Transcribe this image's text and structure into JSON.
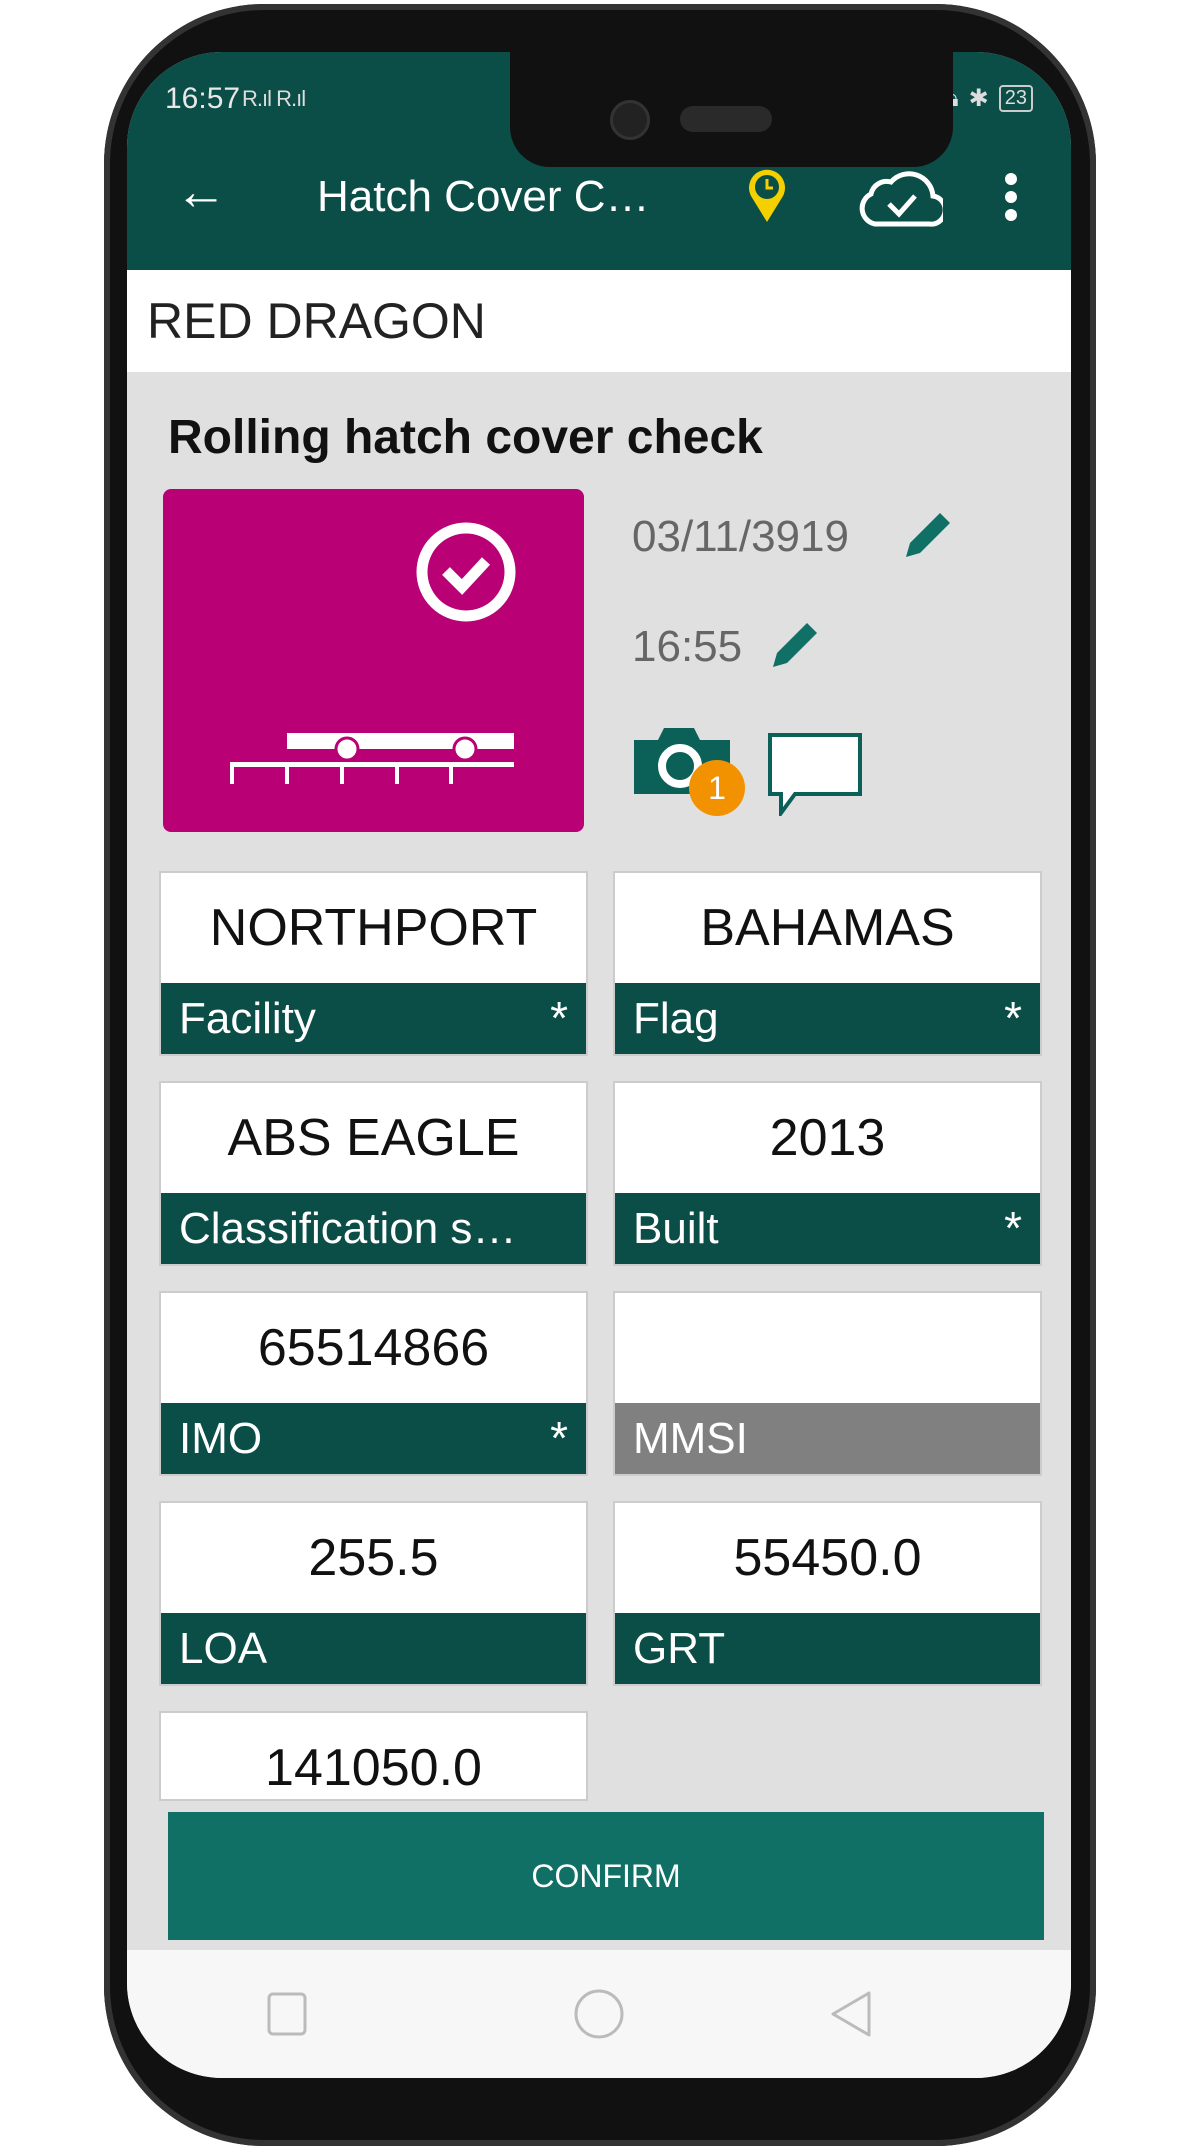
{
  "status_bar": {
    "time": "16:57",
    "signal": "R.ıl R.ıl",
    "battery": "23"
  },
  "app_bar": {
    "title": "Hatch Cover Check",
    "back_icon": "arrow-left-icon",
    "location_icon": "location-clock-pin-icon",
    "sync_icon": "cloud-check-icon",
    "menu_icon": "more-vertical-icon"
  },
  "vessel_name": "RED DRAGON",
  "check": {
    "title": "Rolling hatch cover check",
    "date": "03/11/3919",
    "time": "16:55",
    "photo_count": "1",
    "tile_color": "#b90074"
  },
  "fields": [
    {
      "value": "NORTHPORT",
      "label": "Facility",
      "required": true
    },
    {
      "value": "BAHAMAS",
      "label": "Flag",
      "required": true
    },
    {
      "value": "ABS EAGLE",
      "label": "Classification society",
      "required": false
    },
    {
      "value": "2013",
      "label": "Built",
      "required": true
    },
    {
      "value": "65514866",
      "label": "IMO",
      "required": true
    },
    {
      "value": "",
      "label": "MMSI",
      "required": false,
      "disabled": true
    },
    {
      "value": "255.5",
      "label": "LOA",
      "required": false
    },
    {
      "value": "55450.0",
      "label": "GRT",
      "required": false
    },
    {
      "value": "141050.0",
      "label": "",
      "required": false
    }
  ],
  "confirm_label": "CONFIRM",
  "colors": {
    "primary": "#0b4d47",
    "button": "#107066",
    "accent": "#f39200",
    "pin": "#f5d000"
  }
}
